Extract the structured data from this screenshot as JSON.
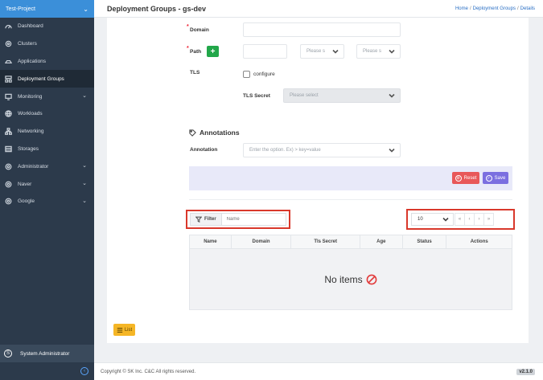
{
  "project": {
    "name": "Test-Project"
  },
  "sidebar": {
    "items": [
      {
        "label": "Dashboard",
        "icon": "dashboard-icon",
        "expandable": false
      },
      {
        "label": "Clusters",
        "icon": "cluster-icon",
        "expandable": false
      },
      {
        "label": "Applications",
        "icon": "applications-icon",
        "expandable": false
      },
      {
        "label": "Deployment Groups",
        "icon": "deployment-groups-icon",
        "expandable": false,
        "active": true
      },
      {
        "label": "Monitoring",
        "icon": "monitor-icon",
        "expandable": true
      },
      {
        "label": "Workloads",
        "icon": "globe-icon",
        "expandable": false
      },
      {
        "label": "Networking",
        "icon": "network-icon",
        "expandable": false
      },
      {
        "label": "Storages",
        "icon": "storage-icon",
        "expandable": false
      },
      {
        "label": "Administrator",
        "icon": "gear-icon",
        "expandable": true
      },
      {
        "label": "Naver",
        "icon": "gear-icon",
        "expandable": true
      },
      {
        "label": "Google",
        "icon": "gear-icon",
        "expandable": true
      }
    ],
    "user": {
      "avatar_letter": "S",
      "name": "System Administrator"
    }
  },
  "header": {
    "title": "Deployment Groups - gs-dev",
    "breadcrumb": [
      "Home",
      "Deployment Groups",
      "Details"
    ]
  },
  "form": {
    "domain_label": "Domain",
    "path_label": "Path",
    "path_select1_placeholder": "Please s",
    "path_select2_placeholder": "Please s",
    "tls_label": "TLS",
    "tls_checkbox_label": "configure",
    "tls_secret_label": "TLS Secret",
    "tls_secret_placeholder": "Please select",
    "annotations_heading": "Annotations",
    "annotation_label": "Annotation",
    "annotation_placeholder": "Enter the option. Ex) > key=value",
    "reset_label": "Reset",
    "save_label": "Save"
  },
  "filter": {
    "label": "Filter",
    "placeholder": "Name"
  },
  "pagination": {
    "page_size": "10",
    "buttons": [
      "«",
      "‹",
      "›",
      "»"
    ]
  },
  "table": {
    "columns": [
      "Name",
      "Domain",
      "Tls Secret",
      "Age",
      "Status",
      "Actions"
    ],
    "empty_text": "No items"
  },
  "list_button": {
    "label": "List"
  },
  "footer": {
    "copyright": "Copyright © SK Inc. C&C All rights reserved.",
    "version": "v2.1.0"
  },
  "colors": {
    "sidebar_bg": "#2c3a4b",
    "project_bar": "#3b8fd9",
    "reset": "#e8585a",
    "save": "#7b6fe0",
    "list": "#f5b626",
    "highlight": "#d9382b"
  }
}
